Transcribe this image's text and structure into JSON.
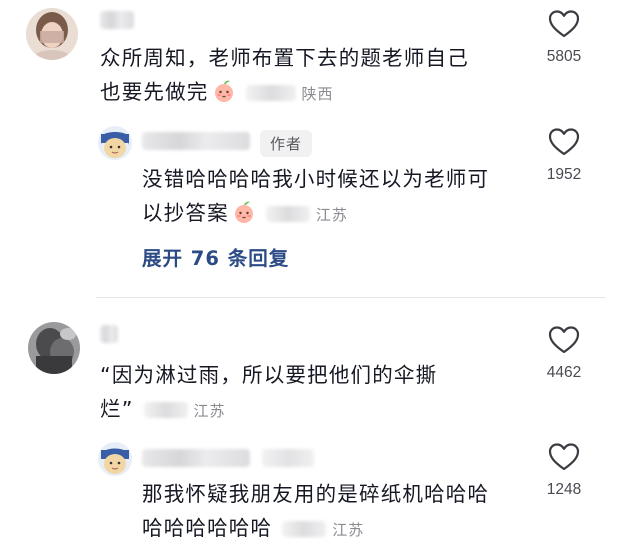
{
  "comments": [
    {
      "text_line1": "众所周知，老师布置下去的题老师自己",
      "text_line2": "也要先做完",
      "location": "陕西",
      "likes": "5805",
      "reply": {
        "author_tag": "作者",
        "text_line1": "没错哈哈哈哈我小时候还以为老师可",
        "text_line2": "以抄答案",
        "location": "江苏",
        "likes": "1952"
      },
      "expand_label": "展开 76 条回复"
    },
    {
      "text_line1": "“因为淋过雨，所以要把他们的伞撕",
      "text_line2": "烂”",
      "location": "江苏",
      "likes": "4462",
      "reply": {
        "text_line1": "那我怀疑我朋友用的是碎纸机哈哈哈",
        "text_line2": "哈哈哈哈哈哈",
        "location": "江苏",
        "likes": "1248"
      }
    }
  ],
  "icons": {
    "like": "heart-outline-icon",
    "emoji": "peach-face-emoji"
  },
  "colors": {
    "link": "#2b4a86",
    "secondary": "#8a8b91",
    "primary": "#161823"
  }
}
